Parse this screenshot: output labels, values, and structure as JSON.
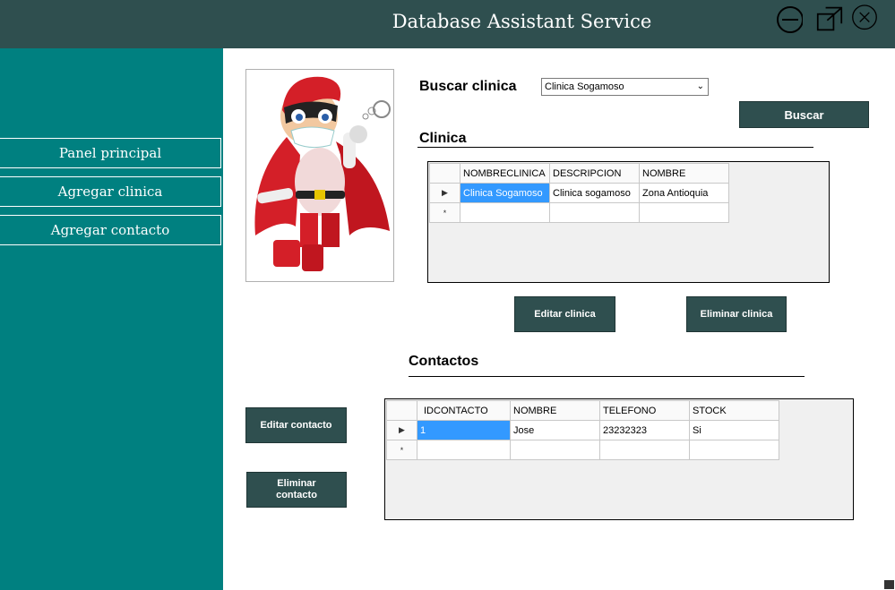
{
  "window": {
    "title": "Database Assistant Service",
    "controls": [
      "minimize-icon",
      "maximize-icon",
      "close-icon"
    ]
  },
  "sidebar": {
    "items": [
      {
        "label": "Panel principal"
      },
      {
        "label": "Agregar clinica"
      },
      {
        "label": "Agregar contacto"
      }
    ]
  },
  "search": {
    "label": "Buscar clinica",
    "selected": "Clinica Sogamoso",
    "button": "Buscar"
  },
  "clinica": {
    "heading": "Clinica",
    "columns": [
      "NOMBRECLINICA",
      "DESCRIPCION",
      "NOMBRE"
    ],
    "rows": [
      [
        "Clinica Sogamoso",
        "Clinica sogamoso",
        "Zona Antioquia"
      ]
    ],
    "edit_button": "Editar clinica",
    "delete_button": "Eliminar clinica"
  },
  "contactos": {
    "heading": "Contactos",
    "columns": [
      "IDCONTACTO",
      "NOMBRE",
      "TELEFONO",
      "STOCK"
    ],
    "rows": [
      [
        "1",
        "Jose",
        "23232323",
        "Si"
      ]
    ],
    "edit_button": "Editar contacto",
    "delete_button_line1": "Eliminar",
    "delete_button_line2": "contacto"
  },
  "colors": {
    "titlebar": "#2f4f4f",
    "sidebar": "#008080",
    "button": "#2f4f4f",
    "selection": "#3399ff"
  }
}
